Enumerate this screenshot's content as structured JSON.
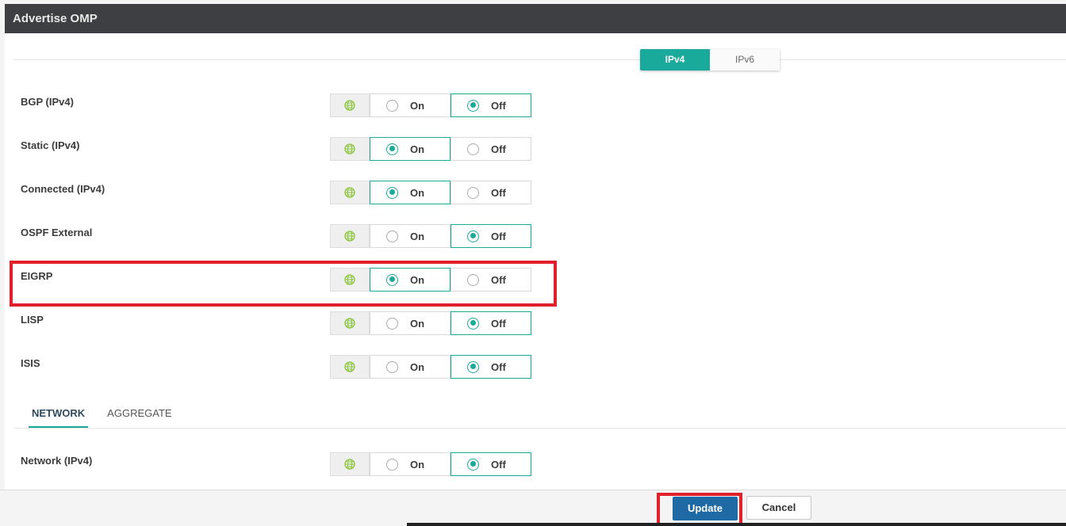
{
  "header": {
    "title": "Advertise OMP"
  },
  "ip_toggle": {
    "options": [
      "IPv4",
      "IPv6"
    ],
    "selected": "IPv4"
  },
  "protocols": [
    {
      "label": "BGP (IPv4)",
      "on_label": "On",
      "off_label": "Off",
      "value": "Off"
    },
    {
      "label": "Static (IPv4)",
      "on_label": "On",
      "off_label": "Off",
      "value": "On"
    },
    {
      "label": "Connected (IPv4)",
      "on_label": "On",
      "off_label": "Off",
      "value": "On"
    },
    {
      "label": "OSPF External",
      "on_label": "On",
      "off_label": "Off",
      "value": "Off"
    },
    {
      "label": "EIGRP",
      "on_label": "On",
      "off_label": "Off",
      "value": "On"
    },
    {
      "label": "LISP",
      "on_label": "On",
      "off_label": "Off",
      "value": "Off"
    },
    {
      "label": "ISIS",
      "on_label": "On",
      "off_label": "Off",
      "value": "Off"
    }
  ],
  "tabs": {
    "network": "NETWORK",
    "aggregate": "AGGREGATE",
    "selected": "NETWORK"
  },
  "network_row": {
    "label": "Network (IPv4)",
    "on_label": "On",
    "off_label": "Off",
    "value": "Off"
  },
  "footer": {
    "update_label": "Update",
    "cancel_label": "Cancel"
  },
  "colors": {
    "accent": "#1aaa9b",
    "header_bg": "#3e3f42",
    "primary_button": "#1f6aa5",
    "highlight": "#e0202a"
  },
  "icons": {
    "scope": "globe-icon",
    "radio": "radio-icon"
  }
}
